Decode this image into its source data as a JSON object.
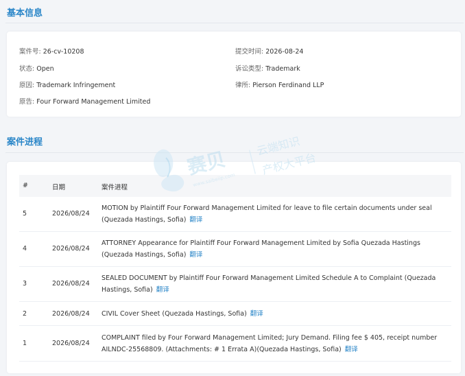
{
  "basic_info": {
    "title": "基本信息",
    "case_no_label": "案件号: ",
    "case_no": "26-cv-10208",
    "submit_time_label": "提交时间: ",
    "submit_time": "2026-08-24",
    "status_label": "状态: ",
    "status": "Open",
    "lawsuit_type_label": "诉讼类型: ",
    "lawsuit_type": "Trademark",
    "cause_label": "原因: ",
    "cause": "Trademark Infringement",
    "law_firm_label": "律所: ",
    "law_firm": "Pierson Ferdinand LLP",
    "plaintiff_label": "原告: ",
    "plaintiff": "Four Forward Management Limited"
  },
  "progress": {
    "title": "案件进程",
    "headers": {
      "num": "#",
      "date": "日期",
      "progress": "案件进程"
    },
    "translate_label": "翻译",
    "rows": [
      {
        "num": "5",
        "date": "2026/08/24",
        "text": "MOTION by Plaintiff Four Forward Management Limited for leave to file certain documents under seal (Quezada Hastings, Sofia)"
      },
      {
        "num": "4",
        "date": "2026/08/24",
        "text": "ATTORNEY Appearance for Plaintiff Four Forward Management Limited by Sofia Quezada Hastings (Quezada Hastings, Sofia)"
      },
      {
        "num": "3",
        "date": "2026/08/24",
        "text": "SEALED DOCUMENT by Plaintiff Four Forward Management Limited Schedule A to Complaint (Quezada Hastings, Sofia)"
      },
      {
        "num": "2",
        "date": "2026/08/24",
        "text": "CIVIL Cover Sheet (Quezada Hastings, Sofia)"
      },
      {
        "num": "1",
        "date": "2026/08/24",
        "text": "COMPLAINT filed by Four Forward Management Limited; Jury Demand. Filing fee $ 405, receipt number AILNDC-25568809. (Attachments: # 1 Errata A)(Quezada Hastings, Sofia)"
      }
    ]
  },
  "watermark": {
    "brand": "赛贝",
    "slogan_line1": "云端知识",
    "slogan_line2": "产权大平台",
    "url": "www.saibeiip.com"
  }
}
